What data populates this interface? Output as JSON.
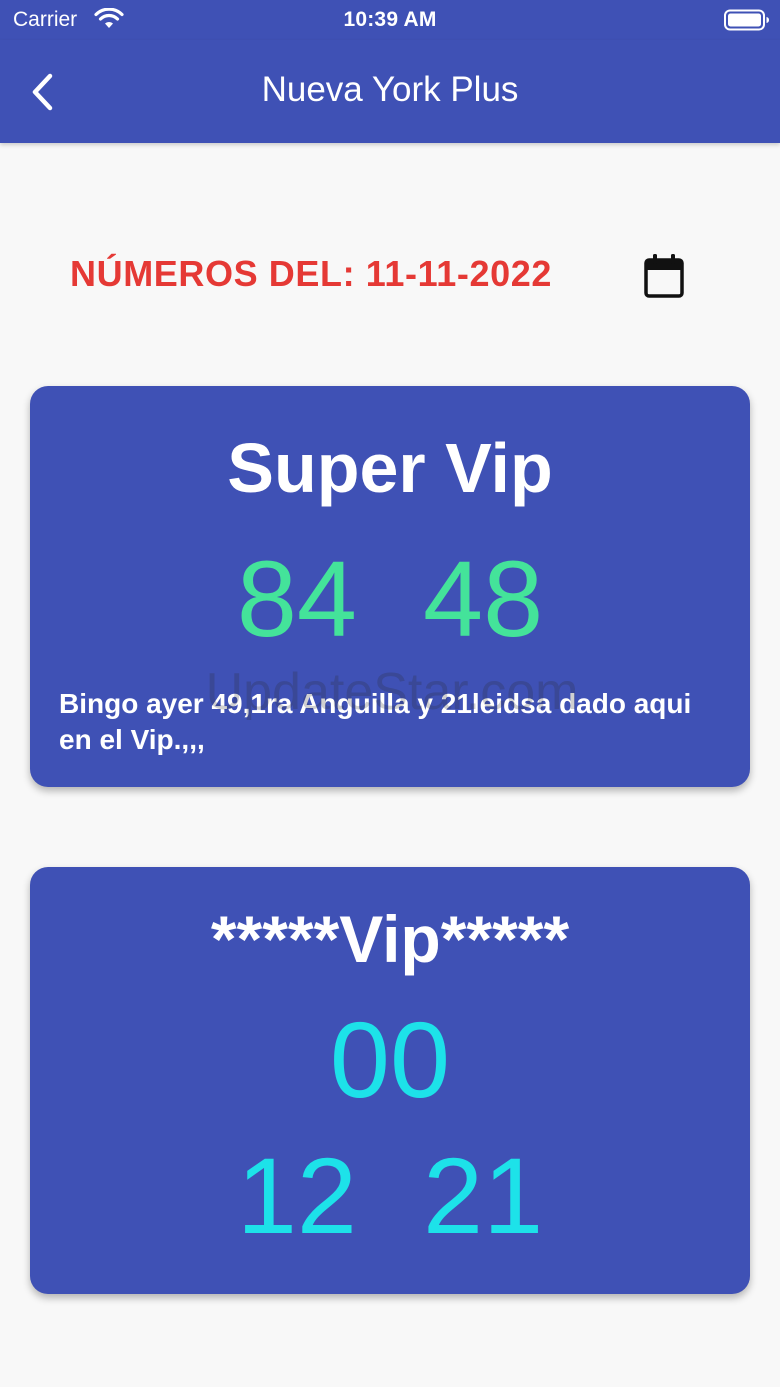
{
  "status_bar": {
    "carrier": "Carrier",
    "time": "10:39 AM",
    "icons": [
      "wifi-icon",
      "battery-icon"
    ]
  },
  "nav": {
    "title": "Nueva York Plus",
    "back_icon": "chevron-left-icon",
    "background_color": "#3f51b5"
  },
  "date_header": {
    "label": "NÚMEROS DEL: 11-11-2022",
    "label_color": "#e53935",
    "calendar_icon": "calendar-icon"
  },
  "cards": [
    {
      "title": "Super Vip",
      "numbers": [
        [
          "84",
          "48"
        ]
      ],
      "number_color": "#44e39a",
      "note": "Bingo ayer 49,1ra Anguilla y 21leidsa dado aqui en el Vip.,,,"
    },
    {
      "title": "*****Vip*****",
      "numbers": [
        [
          "00"
        ],
        [
          "12",
          "21"
        ]
      ],
      "number_color": "#1de2e9"
    }
  ],
  "watermark": "UpdateStar.com"
}
